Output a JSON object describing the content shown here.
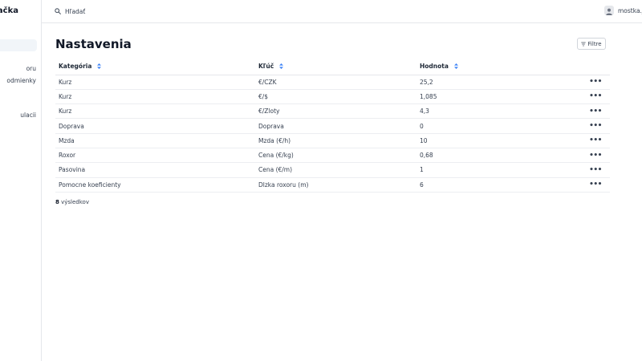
{
  "sidebar": {
    "brand": "ulačka",
    "items": [
      {
        "label": ""
      },
      {
        "label": "oru"
      },
      {
        "label": "odmienky"
      },
      {
        "label": "ulacii"
      }
    ]
  },
  "topbar": {
    "search_placeholder": "Hľadať",
    "username": "mostka.ja"
  },
  "page": {
    "title": "Nastavenia",
    "filter_label": "Filtre"
  },
  "table": {
    "headers": {
      "category": "Kategória",
      "key": "Kľúč",
      "value": "Hodnota"
    },
    "rows": [
      {
        "category": "Kurz",
        "key": "€/CZK",
        "value": "25,2"
      },
      {
        "category": "Kurz",
        "key": "€/$",
        "value": "1,085"
      },
      {
        "category": "Kurz",
        "key": "€/Zloty",
        "value": "4,3"
      },
      {
        "category": "Doprava",
        "key": "Doprava",
        "value": "0"
      },
      {
        "category": "Mzda",
        "key": "Mzda (€/h)",
        "value": "10"
      },
      {
        "category": "Roxor",
        "key": "Cena (€/kg)",
        "value": "0,68"
      },
      {
        "category": "Pasovina",
        "key": "Cena (€/m)",
        "value": "1"
      },
      {
        "category": "Pomocne koeficienty",
        "key": "Dlzka roxoru (m)",
        "value": "6"
      }
    ],
    "row_menu": "•••"
  },
  "footer": {
    "count": "8",
    "count_label": " výsledkov"
  },
  "colors": {
    "accent": "#3b82f6",
    "border": "#e5e7eb",
    "active_bg": "#f1f5f9"
  }
}
